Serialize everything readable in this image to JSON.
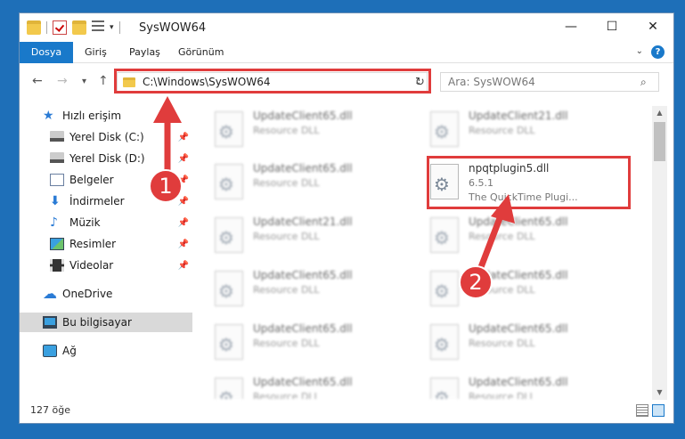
{
  "title_bar": {
    "title": "SysWOW64",
    "qat_dropdown": "▾",
    "minimize": "—",
    "maximize": "☐",
    "close": "✕"
  },
  "ribbon": {
    "tabs": [
      "Dosya",
      "Giriş",
      "Paylaş",
      "Görünüm"
    ],
    "chevron": "⌄",
    "help": "?"
  },
  "nav": {
    "back": "←",
    "forward": "→",
    "recent": "▾",
    "up": "↑",
    "address": "C:\\Windows\\SysWOW64",
    "address_chevron": "⌄",
    "refresh": "↻",
    "search_placeholder": "Ara: SysWOW64",
    "search_icon": "⌕"
  },
  "sidebar": {
    "items": [
      {
        "label": "Hızlı erişim",
        "icon": "star-icon",
        "glyph": "★"
      },
      {
        "label": "Yerel Disk (C:)",
        "icon": "disk-icon"
      },
      {
        "label": "Yerel Disk (D:)",
        "icon": "disk-icon"
      },
      {
        "label": "Belgeler",
        "icon": "documents-icon"
      },
      {
        "label": "İndirmeler",
        "icon": "download-icon",
        "glyph": "⬇"
      },
      {
        "label": "Müzik",
        "icon": "music-icon",
        "glyph": "♪"
      },
      {
        "label": "Resimler",
        "icon": "pictures-icon"
      },
      {
        "label": "Videolar",
        "icon": "videos-icon"
      },
      {
        "label": "OneDrive",
        "icon": "cloud-icon",
        "glyph": "☁"
      },
      {
        "label": "Bu bilgisayar",
        "icon": "computer-icon"
      },
      {
        "label": "Ağ",
        "icon": "network-icon"
      }
    ],
    "pin_glyph": "📌"
  },
  "files": [
    {
      "name": "UpdateClient65.dll",
      "type": "Resource DLL"
    },
    {
      "name": "UpdateClient21.dll",
      "type": "Resource DLL"
    },
    {
      "name": "UpdateClient65.dll",
      "type": "Resource DLL"
    },
    {
      "name": "npqtplugin5.dll",
      "type": "6.5.1",
      "desc": "The QuickTime Plugi..."
    },
    {
      "name": "UpdateClient21.dll",
      "type": "Resource DLL"
    },
    {
      "name": "UpdateClient65.dll",
      "type": "Resource DLL"
    },
    {
      "name": "UpdateClient65.dll",
      "type": "Resource DLL"
    },
    {
      "name": "UpdateClient65.dll",
      "type": "Resource DLL"
    },
    {
      "name": "UpdateClient65.dll",
      "type": "Resource DLL"
    },
    {
      "name": "UpdateClient65.dll",
      "type": "Resource DLL"
    },
    {
      "name": "UpdateClient65.dll",
      "type": "Resource DLL"
    },
    {
      "name": "UpdateClient65.dll",
      "type": "Resource DLL"
    }
  ],
  "scrollbar": {
    "up": "▲",
    "down": "▼"
  },
  "status": {
    "count": "127 öğe"
  },
  "annotations": {
    "badge1": "1",
    "badge2": "2",
    "color": "#e03c3c"
  },
  "colors": {
    "accent": "#1979ca",
    "selection": "#d9d9d9"
  }
}
